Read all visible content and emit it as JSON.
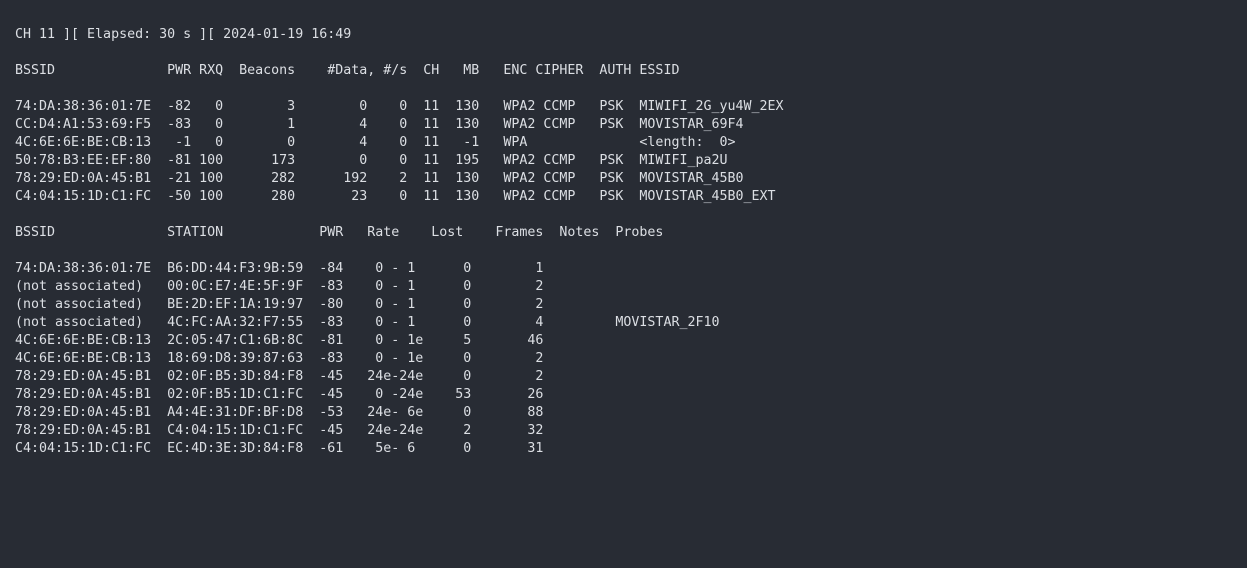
{
  "header": "CH 11 ][ Elapsed: 30 s ][ 2024-01-19 16:49",
  "ap_table": {
    "header": "BSSID              PWR RXQ  Beacons    #Data, #/s  CH   MB   ENC CIPHER  AUTH ESSID",
    "rows": [
      "74:DA:38:36:01:7E  -82   0        3        0    0  11  130   WPA2 CCMP   PSK  MIWIFI_2G_yu4W_2EX",
      "CC:D4:A1:53:69:F5  -83   0        1        4    0  11  130   WPA2 CCMP   PSK  MOVISTAR_69F4",
      "4C:6E:6E:BE:CB:13   -1   0        0        4    0  11   -1   WPA              <length:  0>",
      "50:78:B3:EE:EF:80  -81 100      173        0    0  11  195   WPA2 CCMP   PSK  MIWIFI_pa2U",
      "78:29:ED:0A:45:B1  -21 100      282      192    2  11  130   WPA2 CCMP   PSK  MOVISTAR_45B0",
      "C4:04:15:1D:C1:FC  -50 100      280       23    0  11  130   WPA2 CCMP   PSK  MOVISTAR_45B0_EXT"
    ]
  },
  "station_table": {
    "header": "BSSID              STATION            PWR   Rate    Lost    Frames  Notes  Probes",
    "rows": [
      "74:DA:38:36:01:7E  B6:DD:44:F3:9B:59  -84    0 - 1      0        1",
      "(not associated)   00:0C:E7:4E:5F:9F  -83    0 - 1      0        2",
      "(not associated)   BE:2D:EF:1A:19:97  -80    0 - 1      0        2",
      "(not associated)   4C:FC:AA:32:F7:55  -83    0 - 1      0        4         MOVISTAR_2F10",
      "4C:6E:6E:BE:CB:13  2C:05:47:C1:6B:8C  -81    0 - 1e     5       46",
      "4C:6E:6E:BE:CB:13  18:69:D8:39:87:63  -83    0 - 1e     0        2",
      "78:29:ED:0A:45:B1  02:0F:B5:3D:84:F8  -45   24e-24e     0        2",
      "78:29:ED:0A:45:B1  02:0F:B5:1D:C1:FC  -45    0 -24e    53       26",
      "78:29:ED:0A:45:B1  A4:4E:31:DF:BF:D8  -53   24e- 6e     0       88",
      "78:29:ED:0A:45:B1  C4:04:15:1D:C1:FC  -45   24e-24e     2       32",
      "C4:04:15:1D:C1:FC  EC:4D:3E:3D:84:F8  -61    5e- 6      0       31"
    ]
  }
}
